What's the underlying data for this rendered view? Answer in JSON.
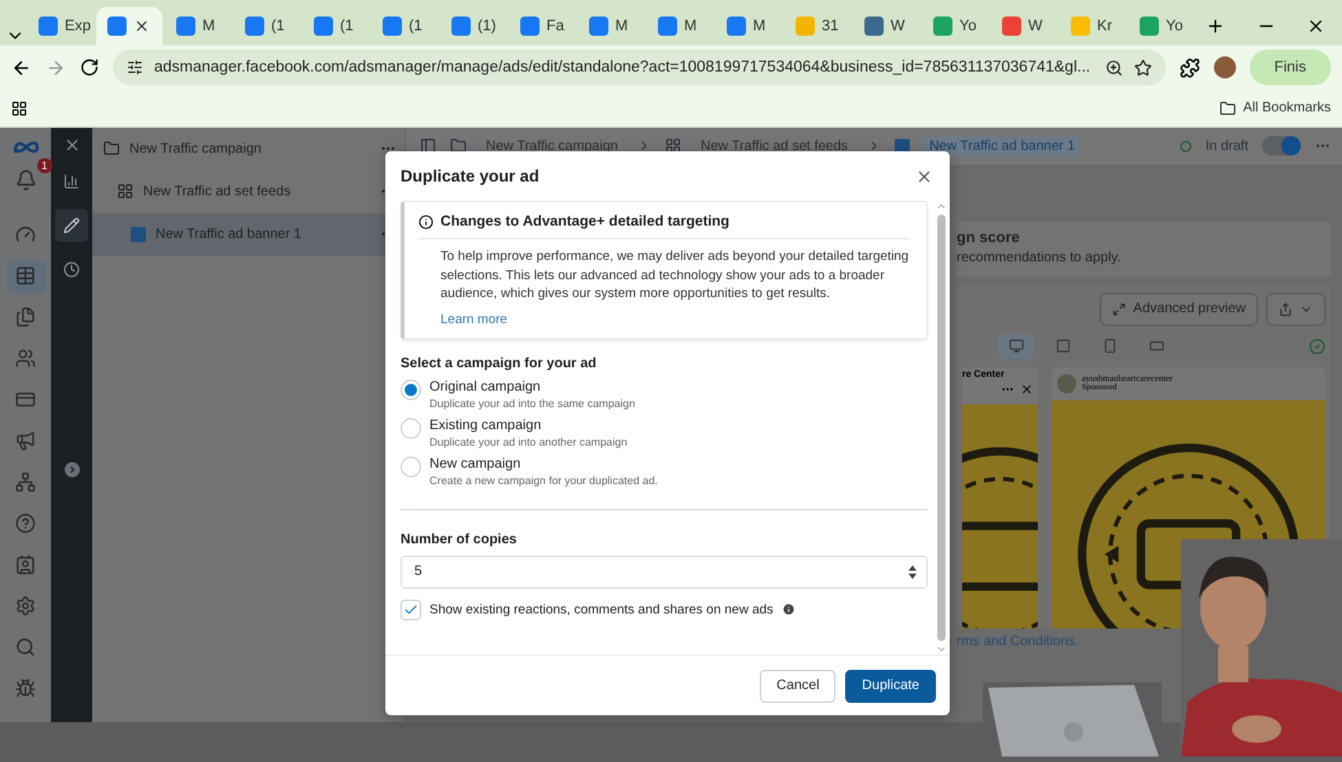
{
  "browser": {
    "tabs": [
      {
        "kind": "meta",
        "label": "Exp",
        "selected": false
      },
      {
        "kind": "meta",
        "selected": true
      },
      {
        "kind": "meta",
        "label": "M",
        "selected": false
      },
      {
        "kind": "facebook",
        "label": "(1",
        "selected": false
      },
      {
        "kind": "facebook",
        "label": "(1",
        "selected": false
      },
      {
        "kind": "facebook",
        "label": "(1",
        "selected": false
      },
      {
        "kind": "facebook",
        "label": "(1)",
        "selected": false
      },
      {
        "kind": "facebook",
        "label": "Fa",
        "selected": false
      },
      {
        "kind": "meta",
        "label": "M",
        "selected": false
      },
      {
        "kind": "meta",
        "label": "M",
        "selected": false
      },
      {
        "kind": "meta",
        "label": "M",
        "selected": false
      },
      {
        "kind": "drive",
        "label": "31",
        "selected": false
      },
      {
        "kind": "wordpress",
        "label": "W",
        "selected": false
      },
      {
        "kind": "sheet",
        "label": "Yo",
        "selected": false
      },
      {
        "kind": "google",
        "label": "W",
        "selected": false
      },
      {
        "kind": "ads",
        "label": "Kr",
        "selected": false
      },
      {
        "kind": "sheet",
        "label": "Yo",
        "selected": false
      }
    ],
    "url": "adsmanager.facebook.com/adsmanager/manage/ads/edit/standalone?act=1008199717534064&business_id=785631137036741&gl...",
    "update_button": "Finis",
    "bookmarks": "All Bookmarks"
  },
  "nav": {
    "notification_count": "1",
    "items": [
      {
        "kind": "gauge",
        "selected": false
      },
      {
        "kind": "table",
        "selected": true
      },
      {
        "kind": "pages",
        "selected": false
      },
      {
        "kind": "people",
        "selected": false
      },
      {
        "kind": "card",
        "selected": false
      },
      {
        "kind": "megaphone",
        "selected": false
      },
      {
        "kind": "network",
        "selected": false
      },
      {
        "kind": "help",
        "selected": false
      },
      {
        "kind": "contact",
        "selected": false
      },
      {
        "kind": "settings",
        "selected": false
      },
      {
        "kind": "search",
        "selected": false
      },
      {
        "kind": "bug",
        "selected": false
      }
    ]
  },
  "tools": [
    {
      "kind": "chart",
      "selected": false
    },
    {
      "kind": "edit",
      "selected": true
    },
    {
      "kind": "history",
      "selected": false
    }
  ],
  "tree": [
    {
      "kind": "campaign",
      "label": "New Traffic campaign",
      "selected": false,
      "children": [
        {
          "kind": "adset",
          "label": "New Traffic ad set feeds",
          "selected": false,
          "children": [
            {
              "kind": "ad",
              "label": "New Traffic ad banner 1",
              "selected": true
            }
          ]
        }
      ]
    }
  ],
  "header": {
    "breadcrumbs": [
      {
        "kind": "campaign",
        "label": "New Traffic campaign",
        "selected": false
      },
      {
        "kind": "adset",
        "label": "New Traffic ad set feeds",
        "selected": false
      },
      {
        "kind": "ad",
        "label": "New Traffic ad banner 1",
        "selected": true
      }
    ],
    "status": "In draft",
    "toggle_on": true
  },
  "score": {
    "title": "gn score",
    "subtitle": "recommendations to apply."
  },
  "preview": {
    "advanced_button": "Advanced preview",
    "devices": [
      {
        "kind": "desktop",
        "selected": true
      },
      {
        "kind": "square",
        "selected": false
      },
      {
        "kind": "phone",
        "selected": false
      },
      {
        "kind": "landscape",
        "selected": false
      }
    ],
    "left_page": "re Center",
    "right_page": "ayushmanheartcarecenter",
    "right_sponsored": "Sponsored"
  },
  "terms_link": "rms and Conditions.",
  "dialog": {
    "title": "Duplicate your ad",
    "notice": {
      "title": "Changes to Advantage+ detailed targeting",
      "body": "To help improve performance, we may deliver ads beyond your detailed targeting selections. This lets our advanced ad technology show your ads to a broader audience, which gives our system more opportunities to get results.",
      "link": "Learn more"
    },
    "campaign_label": "Select a campaign for your ad",
    "options": [
      {
        "label": "Original campaign",
        "description": "Duplicate your ad into the same campaign",
        "selected": true
      },
      {
        "label": "Existing campaign",
        "description": "Duplicate your ad into another campaign",
        "selected": false
      },
      {
        "label": "New campaign",
        "description": "Create a new campaign for your duplicated ad.",
        "selected": false
      }
    ],
    "copies_label": "Number of copies",
    "copies_value": "5",
    "show_reactions": {
      "label": "Show existing reactions, comments and shares on new ads",
      "checked": true
    },
    "buttons": [
      {
        "kind": "secondary",
        "label": "Cancel"
      },
      {
        "kind": "primary",
        "label": "Duplicate"
      }
    ]
  }
}
